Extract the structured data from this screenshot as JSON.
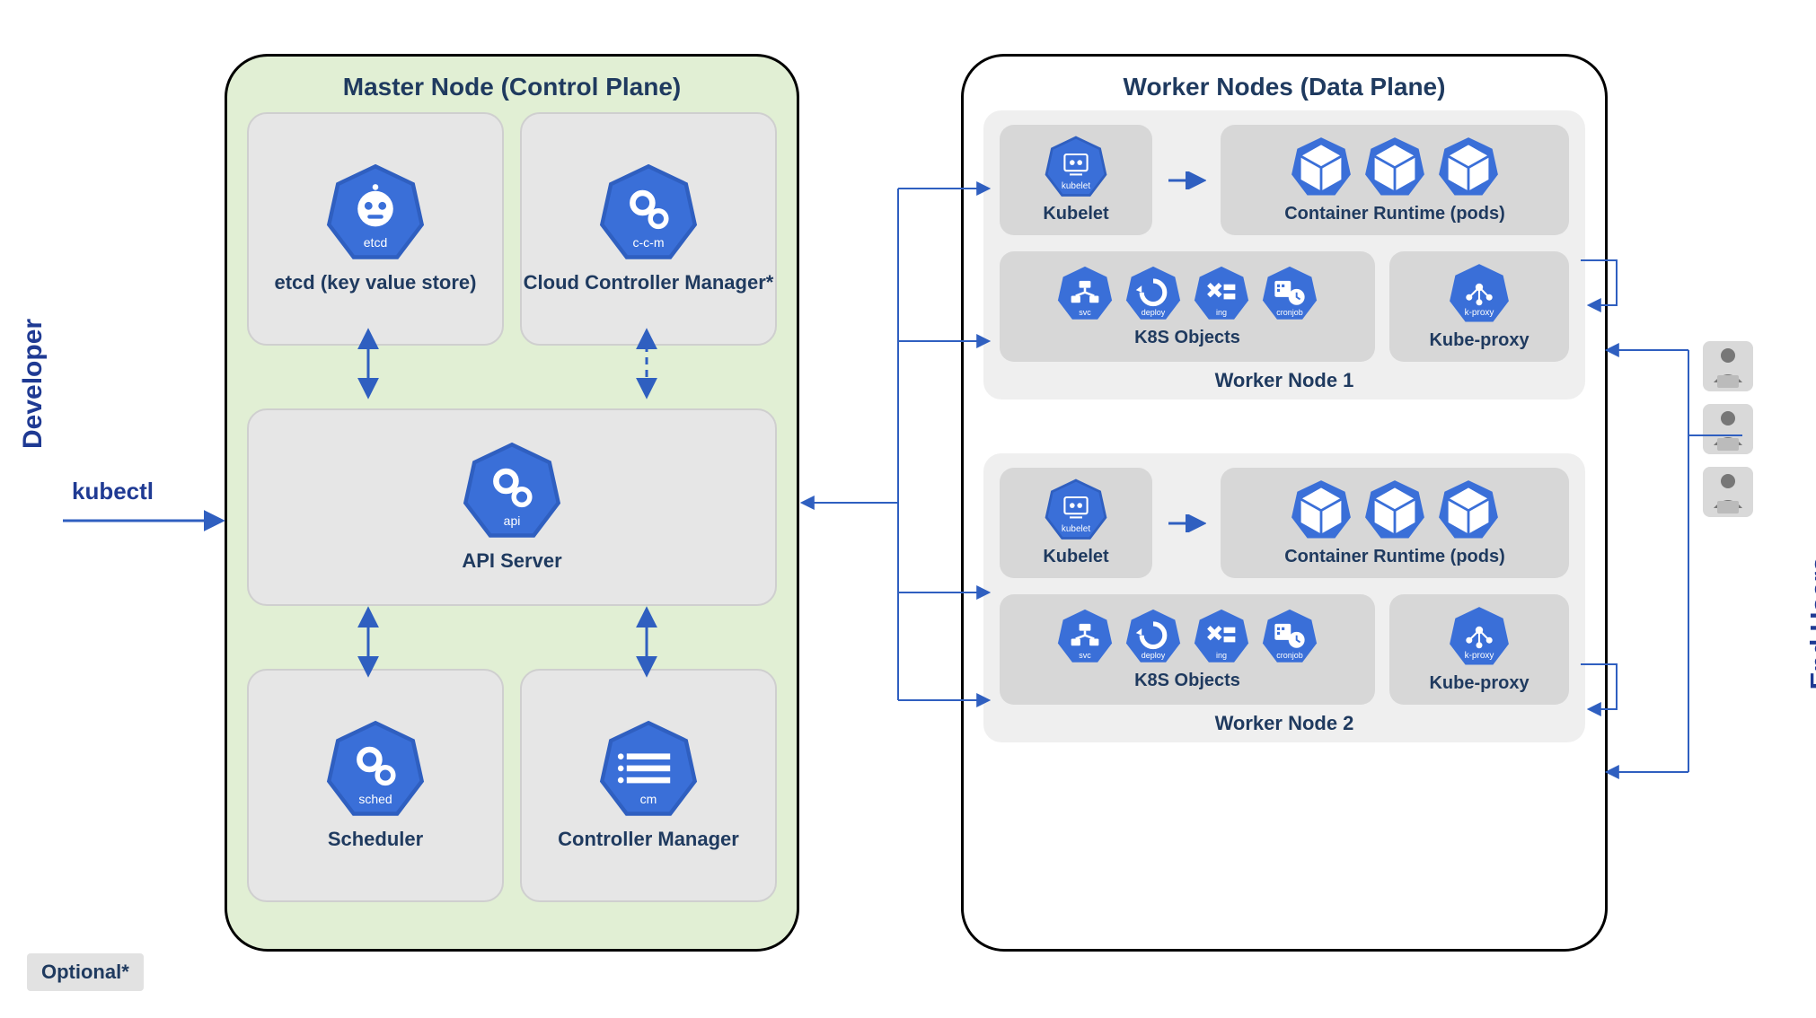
{
  "colors": {
    "k8s_blue": "#3a6fd8",
    "hept_border": "#2f5fc0",
    "text_navy": "#1f3a5f"
  },
  "side": {
    "developer": "Developer",
    "end_users": "End Users",
    "kubectl": "kubectl",
    "optional": "Optional*"
  },
  "master": {
    "title": "Master Node (Control Plane)",
    "etcd": {
      "icon_sub": "etcd",
      "caption": "etcd (key value store)"
    },
    "ccm": {
      "icon_sub": "c-c-m",
      "caption": "Cloud Controller Manager*"
    },
    "api": {
      "icon_sub": "api",
      "caption": "API Server"
    },
    "sched": {
      "icon_sub": "sched",
      "caption": "Scheduler"
    },
    "cm": {
      "icon_sub": "cm",
      "caption": "Controller Manager"
    }
  },
  "workers": {
    "title": "Worker Nodes (Data Plane)",
    "node1": {
      "title": "Worker Node 1",
      "kubelet": {
        "icon_sub": "kubelet",
        "caption": "Kubelet"
      },
      "runtime_caption": "Container Runtime  (pods)",
      "objects": {
        "caption": "K8S Objects",
        "items": [
          {
            "sub": "svc"
          },
          {
            "sub": "deploy"
          },
          {
            "sub": "ing"
          },
          {
            "sub": "cronjob"
          }
        ]
      },
      "kproxy": {
        "icon_sub": "k-proxy",
        "caption": "Kube-proxy"
      }
    },
    "node2": {
      "title": "Worker Node 2",
      "kubelet": {
        "icon_sub": "kubelet",
        "caption": "Kubelet"
      },
      "runtime_caption": "Container Runtime  (pods)",
      "objects": {
        "caption": "K8S Objects",
        "items": [
          {
            "sub": "svc"
          },
          {
            "sub": "deploy"
          },
          {
            "sub": "ing"
          },
          {
            "sub": "cronjob"
          }
        ]
      },
      "kproxy": {
        "icon_sub": "k-proxy",
        "caption": "Kube-proxy"
      }
    }
  }
}
